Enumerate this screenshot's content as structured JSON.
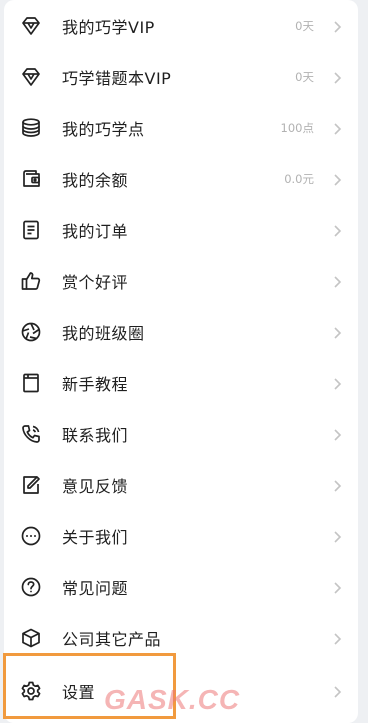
{
  "menu": [
    {
      "label": "我的巧学VIP",
      "value": "0天",
      "icon": "diamond-icon"
    },
    {
      "label": "巧学错题本VIP",
      "value": "0天",
      "icon": "diamond-icon"
    },
    {
      "label": "我的巧学点",
      "value": "100点",
      "icon": "coins-stack-icon"
    },
    {
      "label": "我的余额",
      "value": "0.0元",
      "icon": "wallet-icon"
    },
    {
      "label": "我的订单",
      "value": "",
      "icon": "document-icon"
    },
    {
      "label": "赏个好评",
      "value": "",
      "icon": "thumbs-up-icon"
    },
    {
      "label": "我的班级圈",
      "value": "",
      "icon": "aperture-icon"
    },
    {
      "label": "新手教程",
      "value": "",
      "icon": "book-icon"
    },
    {
      "label": "联系我们",
      "value": "",
      "icon": "phone-icon"
    },
    {
      "label": "意见反馈",
      "value": "",
      "icon": "edit-icon"
    },
    {
      "label": "关于我们",
      "value": "",
      "icon": "more-dots-icon"
    },
    {
      "label": "常见问题",
      "value": "",
      "icon": "question-icon"
    },
    {
      "label": "公司其它产品",
      "value": "",
      "icon": "cube-icon"
    },
    {
      "label": "设置",
      "value": "",
      "icon": "gear-icon"
    }
  ],
  "watermark": "GASK.CC",
  "colors": {
    "highlight": "#f19a3e",
    "label": "#1f1f1f",
    "value": "#b2b2b2"
  }
}
